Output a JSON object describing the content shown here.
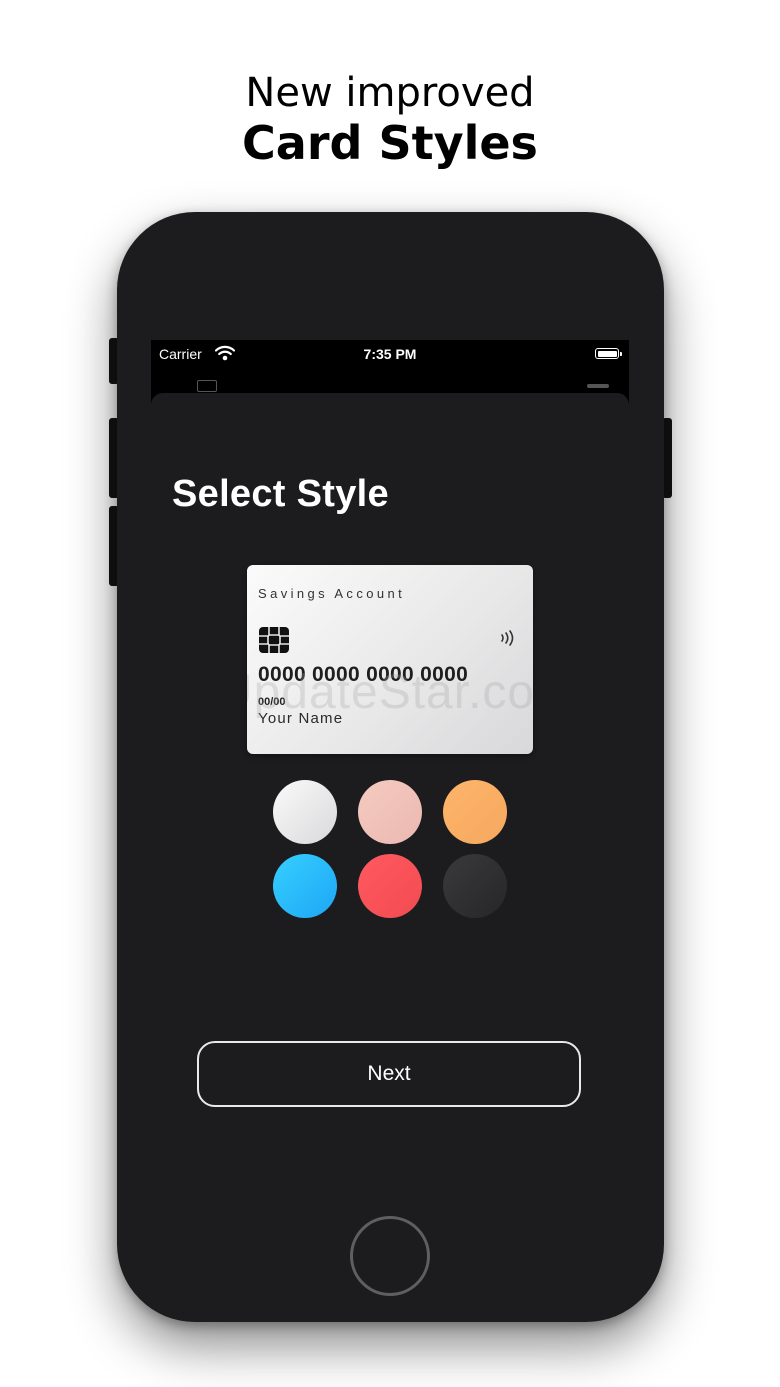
{
  "headline": {
    "line1": "New improved",
    "line2": "Card Styles"
  },
  "status_bar": {
    "carrier": "Carrier",
    "time": "7:35 PM",
    "wifi_icon": "wifi-icon",
    "battery_icon": "battery-icon"
  },
  "sheet": {
    "title": "Select Style"
  },
  "card": {
    "account_type": "Savings Account",
    "number": "0000 0000 0000 0000",
    "expiry": "00/00",
    "name": "Your Name",
    "watermark": "UpdateStar.com",
    "chip_icon": "chip-icon",
    "contactless_icon": "contactless-icon"
  },
  "styles": {
    "colors": [
      "#ececed",
      "#f2c3bb",
      "#faae63",
      "#28bdfb",
      "#fb5258",
      "#303032"
    ]
  },
  "actions": {
    "next_label": "Next"
  }
}
